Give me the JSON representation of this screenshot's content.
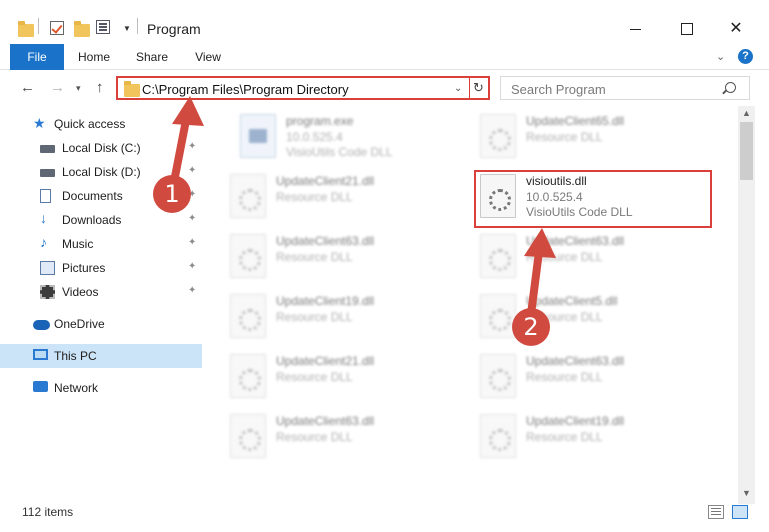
{
  "window": {
    "title": "Program",
    "help": "?"
  },
  "ribbon": {
    "tabs": [
      "File",
      "Home",
      "Share",
      "View"
    ]
  },
  "address": {
    "path": "C:\\Program Files\\Program Directory"
  },
  "search": {
    "placeholder": "Search Program"
  },
  "sidebar": {
    "quick_access": "Quick access",
    "items": [
      {
        "label": "Local Disk (C:)",
        "icon": "drive-icon"
      },
      {
        "label": "Local Disk (D:)",
        "icon": "drive-icon"
      },
      {
        "label": "Documents",
        "icon": "documents-icon"
      },
      {
        "label": "Downloads",
        "icon": "downloads-icon"
      },
      {
        "label": "Music",
        "icon": "music-icon"
      },
      {
        "label": "Pictures",
        "icon": "pictures-icon"
      },
      {
        "label": "Videos",
        "icon": "videos-icon"
      }
    ],
    "onedrive": "OneDrive",
    "this_pc": "This PC",
    "network": "Network"
  },
  "files": [
    {
      "name": "program.exe",
      "line1": "10.0.525.4",
      "line2": "VisioUtils Code DLL"
    },
    {
      "name": "UpdateClient65.dll",
      "line1": "Resource DLL",
      "line2": ""
    },
    {
      "name": "UpdateClient21.dll",
      "line1": "Resource DLL",
      "line2": ""
    },
    {
      "name": "visioutils.dll",
      "line1": "10.0.525.4",
      "line2": "VisioUtils Code DLL"
    },
    {
      "name": "UpdateClient63.dll",
      "line1": "Resource DLL",
      "line2": ""
    },
    {
      "name": "UpdateClient63.dll",
      "line1": "Resource DLL",
      "line2": ""
    },
    {
      "name": "UpdateClient19.dll",
      "line1": "Resource DLL",
      "line2": ""
    },
    {
      "name": "UpdateClient5.dll",
      "line1": "Resource DLL",
      "line2": ""
    },
    {
      "name": "UpdateClient21.dll",
      "line1": "Resource DLL",
      "line2": ""
    },
    {
      "name": "UpdateClient63.dll",
      "line1": "Resource DLL",
      "line2": ""
    },
    {
      "name": "UpdateClient63.dll",
      "line1": "Resource DLL",
      "line2": ""
    },
    {
      "name": "UpdateClient19.dll",
      "line1": "Resource DLL",
      "line2": ""
    }
  ],
  "status": {
    "item_count": "112 items"
  },
  "annotations": {
    "step1": "1",
    "step2": "2",
    "color": "#d14a3f"
  }
}
